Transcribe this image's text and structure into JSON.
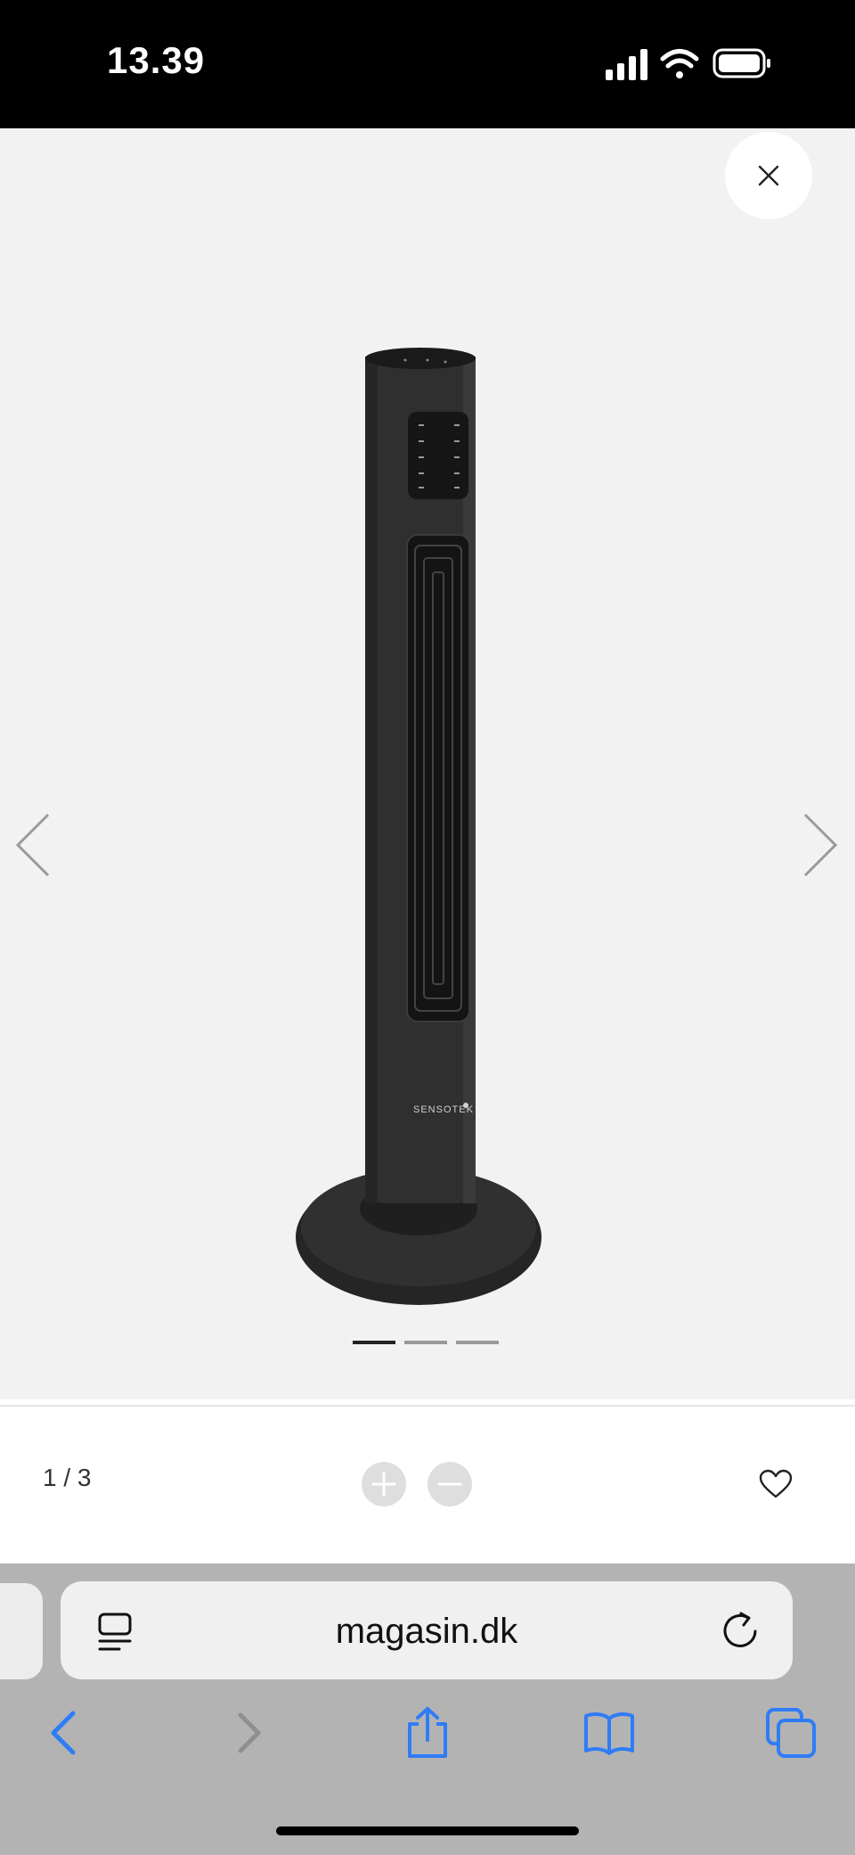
{
  "status_bar": {
    "time": "13.39",
    "icons": [
      "cellular-signal-icon",
      "wifi-icon",
      "battery-icon"
    ]
  },
  "gallery": {
    "image_alt": "SENSOTEK",
    "dots": {
      "count": 3,
      "active_index": 0
    },
    "colors": {
      "background": "#f2f2f2",
      "active_dot": "#222222",
      "inactive_dot": "#999999"
    }
  },
  "controls": {
    "counter": "1 / 3",
    "icons": [
      "zoom-in-icon",
      "zoom-out-icon",
      "heart-icon"
    ]
  },
  "safari": {
    "url": "magasin.dk",
    "accent_color": "#2f7cf6",
    "icons": [
      "reader-icon",
      "reload-icon",
      "back-icon",
      "forward-icon",
      "share-icon",
      "bookmarks-icon",
      "tabs-icon"
    ]
  }
}
